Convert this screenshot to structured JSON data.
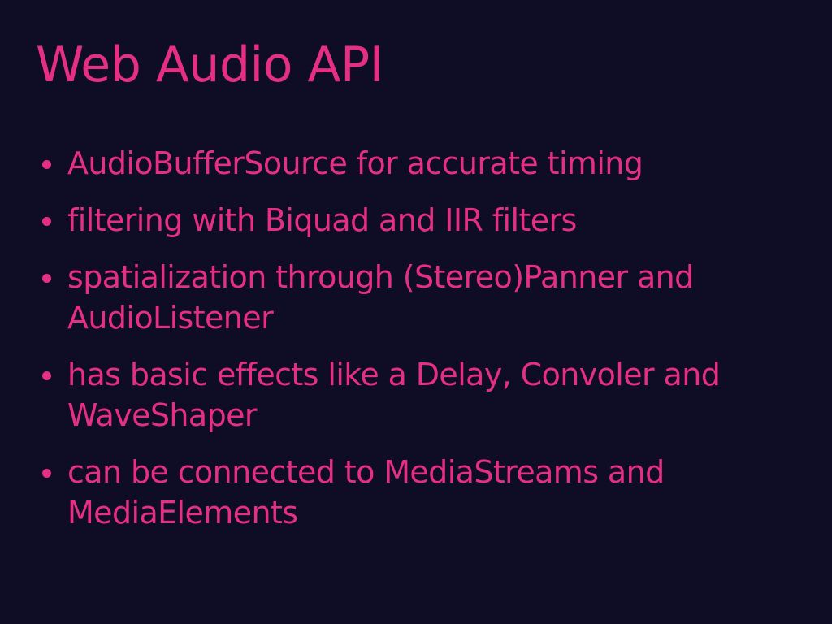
{
  "slide": {
    "title": "Web Audio API",
    "bullets": [
      "AudioBufferSource for accurate timing",
      "filtering with Biquad and IIR filters",
      "spatialization through (Stereo)Panner and AudioListener",
      "has basic effects like a Delay, Convoler and WaveShaper",
      "can be connected to MediaStreams and MediaElements"
    ]
  },
  "colors": {
    "background": "#0f0c26",
    "accent": "#e52f86"
  }
}
